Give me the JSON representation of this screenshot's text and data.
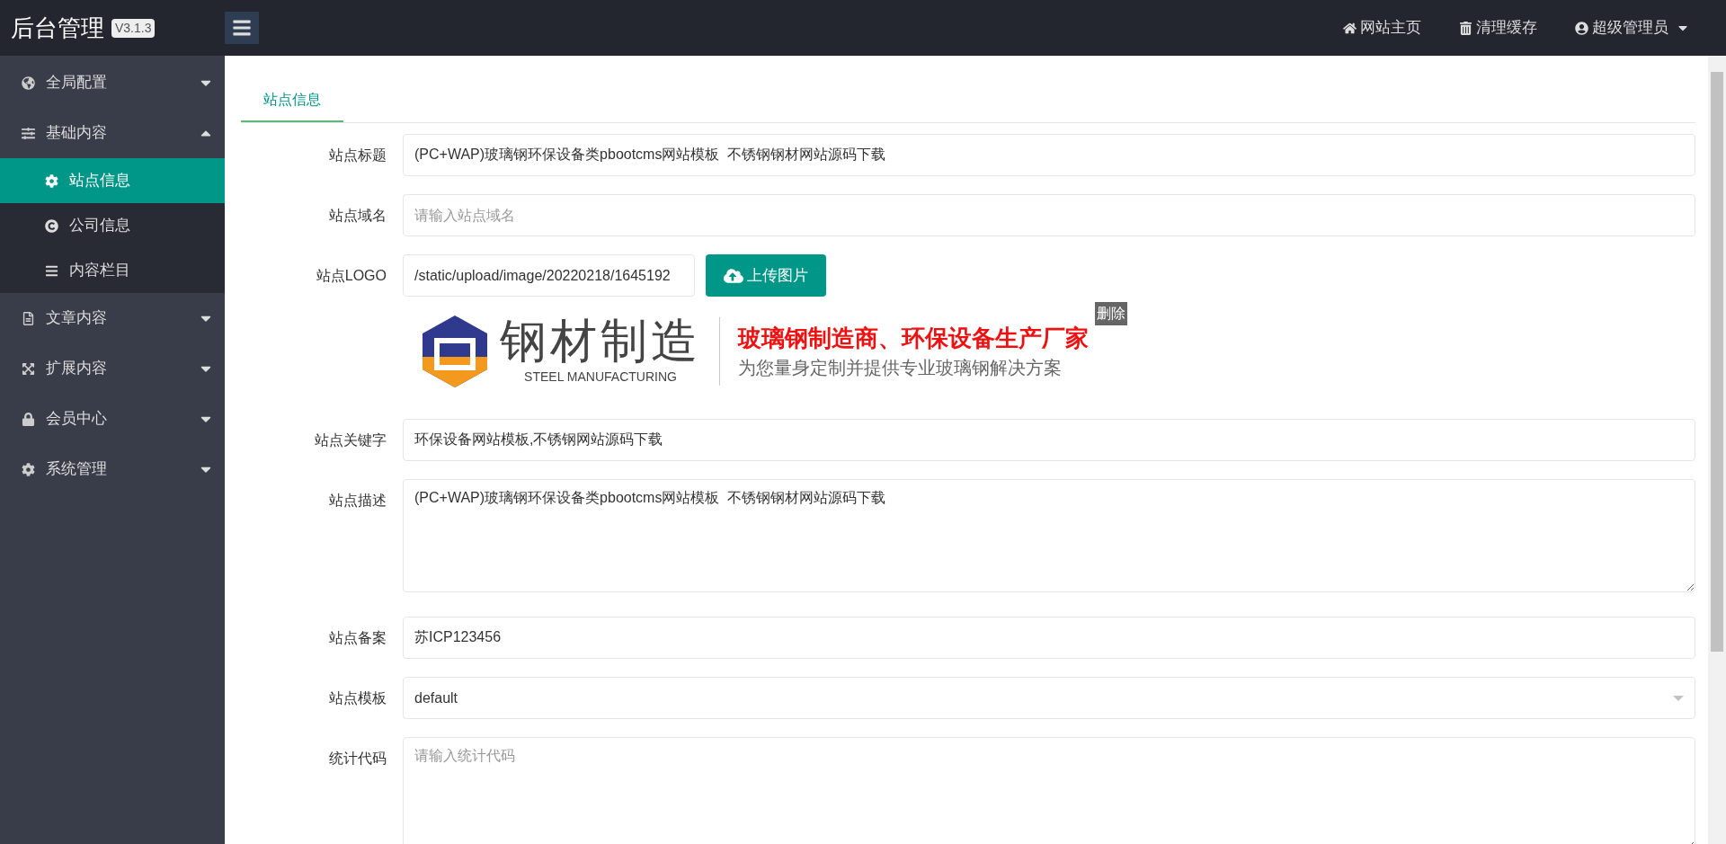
{
  "header": {
    "title": "后台管理",
    "version": "V3.1.3",
    "links": [
      {
        "kind": "home",
        "label": "网站主页"
      },
      {
        "kind": "trash",
        "label": "清理缓存"
      },
      {
        "kind": "user",
        "label": "超级管理员"
      }
    ]
  },
  "sidebar": {
    "items": [
      {
        "kind": "globe",
        "label": "全局配置",
        "expanded": false
      },
      {
        "kind": "sliders",
        "label": "基础内容",
        "expanded": true,
        "children": [
          {
            "kind": "gear",
            "label": "站点信息",
            "selected": true
          },
          {
            "kind": "copyright",
            "label": "公司信息",
            "selected": false
          },
          {
            "kind": "list",
            "label": "内容栏目",
            "selected": false
          }
        ]
      },
      {
        "kind": "file",
        "label": "文章内容",
        "expanded": false
      },
      {
        "kind": "expand",
        "label": "扩展内容",
        "expanded": false
      },
      {
        "kind": "lock",
        "label": "会员中心",
        "expanded": false
      },
      {
        "kind": "gear",
        "label": "系统管理",
        "expanded": false
      }
    ]
  },
  "tabs": [
    {
      "label": "站点信息",
      "selected": true
    }
  ],
  "form": [
    {
      "kind": "text",
      "label": "站点标题",
      "value": "(PC+WAP)玻璃钢环保设备类pbootcms网站模板  不锈钢钢材网站源码下载"
    },
    {
      "kind": "text",
      "label": "站点域名",
      "placeholder": "请输入站点域名"
    },
    {
      "kind": "upload",
      "label": "站点LOGO",
      "value": "/static/upload/image/20220218/1645192",
      "button": "上传图片",
      "delete": "删除",
      "logo": {
        "name": "钢材制造",
        "english": "STEEL MANUFACTURING",
        "slogan": "玻璃钢制造商、环保设备生产厂家",
        "tagline": "为您量身定制并提供专业玻璃钢解决方案"
      }
    },
    {
      "kind": "text",
      "label": "站点关键字",
      "value": "环保设备网站模板,不锈钢网站源码下载"
    },
    {
      "kind": "textarea",
      "label": "站点描述",
      "value": "(PC+WAP)玻璃钢环保设备类pbootcms网站模板  不锈钢钢材网站源码下载"
    },
    {
      "kind": "text",
      "label": "站点备案",
      "value": "苏ICP123456"
    },
    {
      "kind": "select",
      "label": "站点模板",
      "value": "default"
    },
    {
      "kind": "textarea",
      "label": "统计代码",
      "placeholder": "请输入统计代码"
    }
  ]
}
